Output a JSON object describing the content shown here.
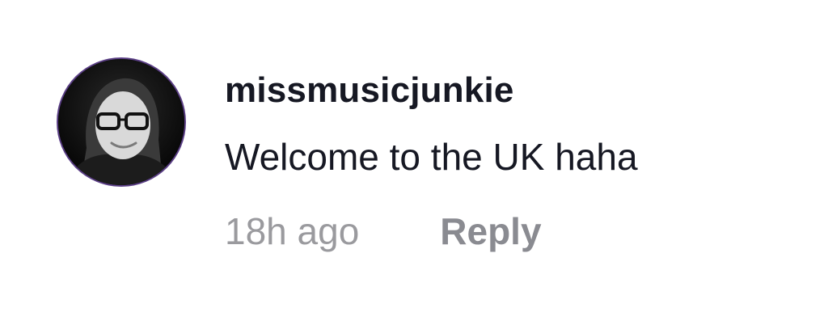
{
  "comment": {
    "avatar_icon": "user-profile-photo",
    "username": "missmusicjunkie",
    "text": "Welcome to the UK haha",
    "timestamp": "18h ago",
    "reply_label": "Reply"
  },
  "colors": {
    "primary_text": "#161823",
    "secondary_text": "#9a9a9e",
    "avatar_ring": "#5b3f86"
  }
}
